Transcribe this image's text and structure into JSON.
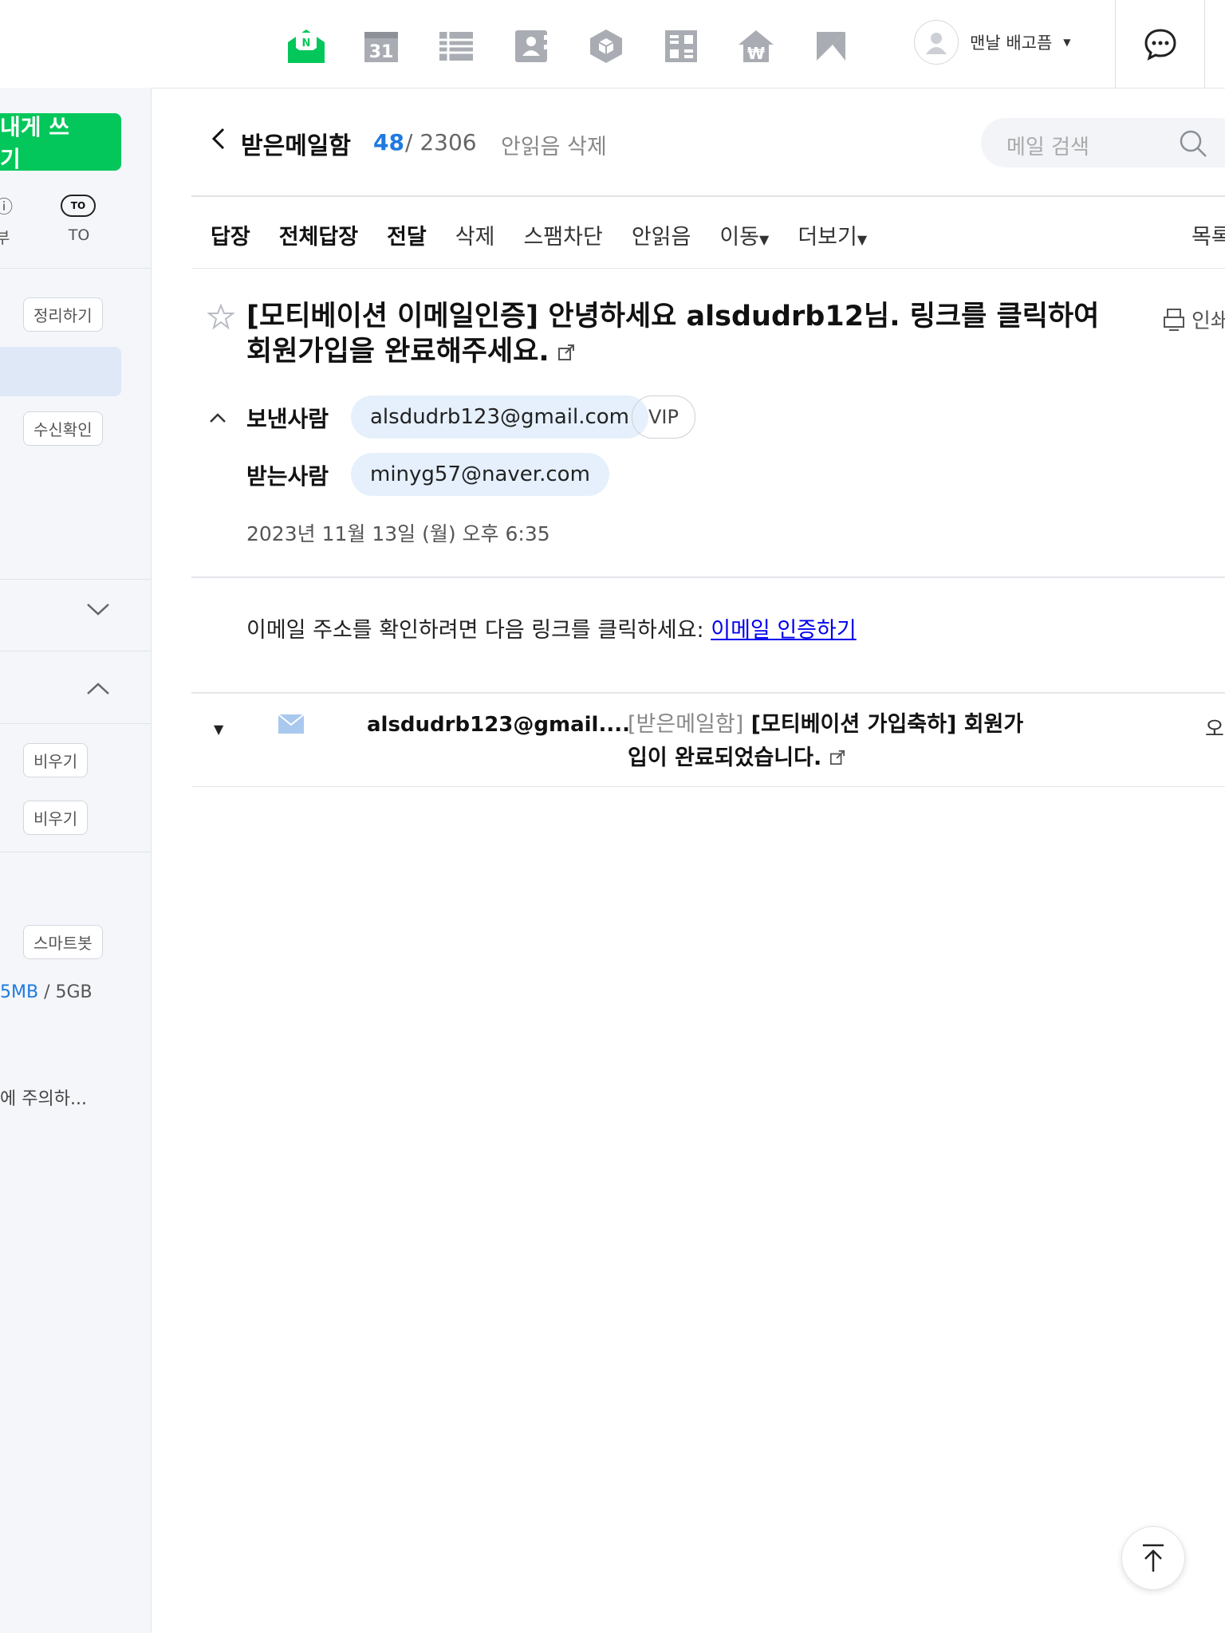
{
  "profile": {
    "name": "맨날 배고픔"
  },
  "sidebar": {
    "compose_label": "내게 쓰기",
    "quick_left_label": "부",
    "to_badge": "TO",
    "to_label": "TO",
    "organize_label": "정리하기",
    "receipt_label": "수신확인",
    "empty_label_1": "비우기",
    "empty_label_2": "비우기",
    "smartbot_label": "스마트봇",
    "storage_used": "5MB",
    "storage_sep": " / ",
    "storage_total": "5GB",
    "notice": "에 주의하..."
  },
  "header": {
    "title": "받은메일함",
    "unread": "48",
    "total": "/ 2306",
    "delete_unread": "안읽음 삭제",
    "search_placeholder": "메일 검색"
  },
  "toolbar": {
    "reply": "답장",
    "reply_all": "전체답장",
    "forward": "전달",
    "delete": "삭제",
    "spam_block": "스팸차단",
    "mark_unread": "안읽음",
    "move": "이동",
    "more": "더보기",
    "list": "목록"
  },
  "message": {
    "subject": "[모티베이션 이메일인증] 안녕하세요 alsdudrb12님. 링크를 클릭하여 회원가입을 완료해주세요.",
    "print_label": "인쇄",
    "sender_label": "보낸사람",
    "sender": "alsdudrb123@gmail.com",
    "vip": "VIP",
    "recipient_label": "받는사람",
    "recipient": "minyg57@naver.com",
    "date": "2023년 11월 13일 (월) 오후 6:35",
    "body_text": "이메일 주소를 확인하려면 다음 링크를 클릭하세요: ",
    "body_link": "이메일 인증하기"
  },
  "related": {
    "from": "alsdudrb123@gmail....",
    "folder": "[받은메일함]",
    "subject": " [모티베이션 가입축하] 회원가입이 완료되었습니다.",
    "time": "오"
  },
  "colors": {
    "accent_green": "#03c75a",
    "link_blue": "#1f7ae0"
  }
}
